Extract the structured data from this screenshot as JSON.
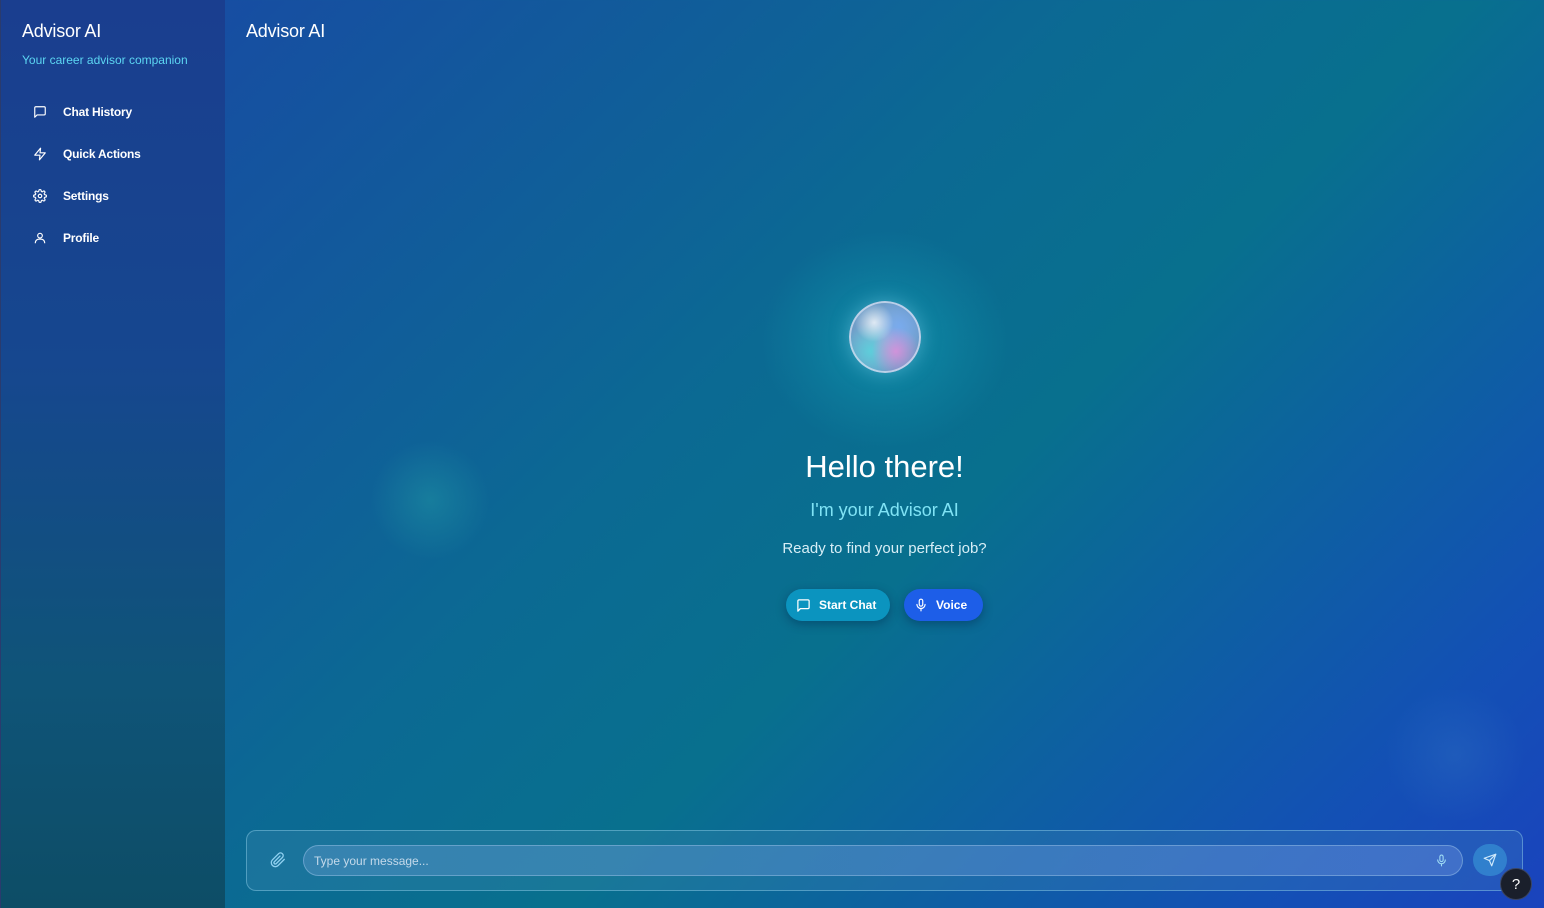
{
  "sidebar": {
    "title": "Advisor AI",
    "subtitle": "Your career advisor companion",
    "items": [
      {
        "label": "Chat History",
        "icon": "message-square-icon"
      },
      {
        "label": "Quick Actions",
        "icon": "lightning-icon"
      },
      {
        "label": "Settings",
        "icon": "gear-icon"
      },
      {
        "label": "Profile",
        "icon": "user-icon"
      }
    ]
  },
  "header": {
    "title": "Advisor AI"
  },
  "hero": {
    "greeting": "Hello there!",
    "intro": "I'm your Advisor AI",
    "prompt": "Ready to find your perfect job?",
    "start_chat_label": "Start Chat",
    "voice_label": "Voice"
  },
  "composer": {
    "placeholder": "Type your message...",
    "value": ""
  },
  "help": {
    "label": "?"
  },
  "colors": {
    "accent_cyan": "#5cd6f2",
    "start_chat_button": "#0b94bf",
    "voice_button": "#1d5ee8"
  }
}
